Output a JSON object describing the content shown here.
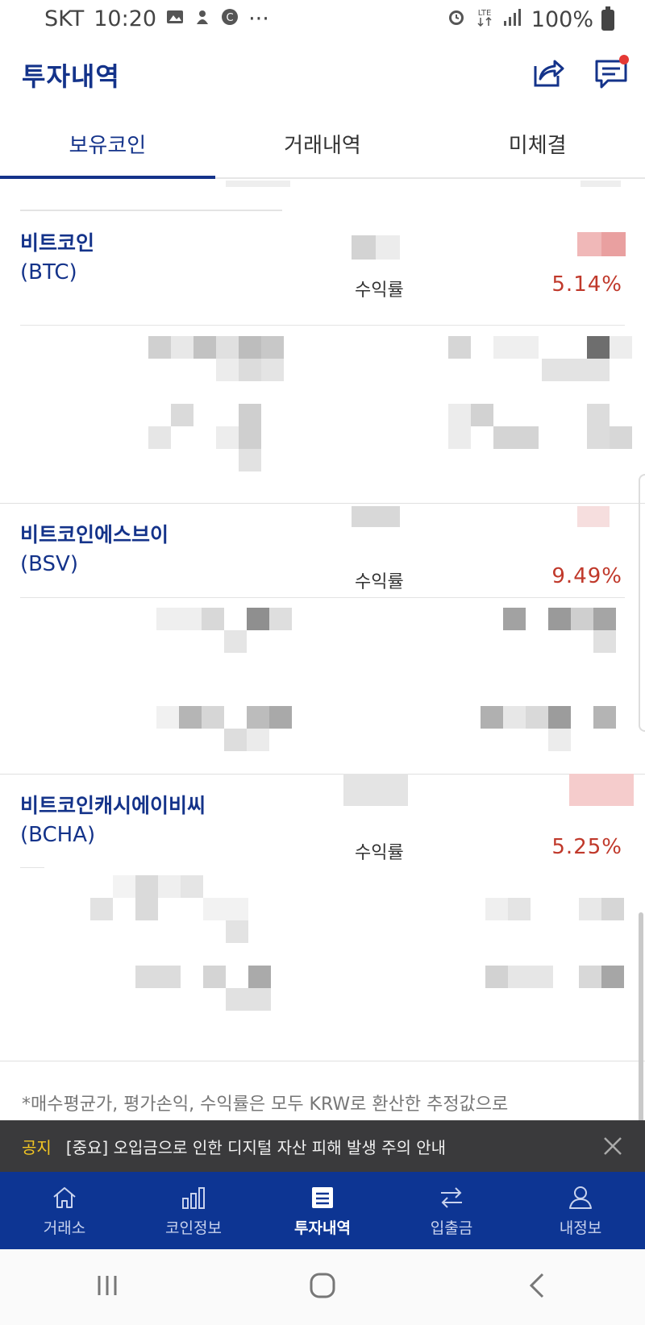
{
  "status_bar": {
    "carrier": "SKT",
    "time": "10:20",
    "icons": [
      "image-icon",
      "alarm-icon",
      "lte-icon",
      "signal-icon"
    ],
    "more": "···",
    "battery": "100%"
  },
  "header": {
    "title": "투자내역",
    "icons": [
      "share-icon",
      "chat-icon"
    ]
  },
  "tabs": [
    {
      "label": "보유코인",
      "active": true
    },
    {
      "label": "거래내역",
      "active": false
    },
    {
      "label": "미체결",
      "active": false
    }
  ],
  "holdings": [
    {
      "name": "비트코인",
      "symbol": "(BTC)",
      "yield_label": "수익률",
      "yield_value": "5.14%"
    },
    {
      "name": "비트코인에스브이",
      "symbol": "(BSV)",
      "yield_label": "수익률",
      "yield_value": "9.49%"
    },
    {
      "name": "비트코인캐시에이비씨",
      "symbol": "(BCHA)",
      "yield_label": "수익률",
      "yield_value": "5.25%"
    }
  ],
  "footnote": "*매수평균가, 평가손익, 수익률은 모두 KRW로 환산한 추정값으로",
  "notice": {
    "tag": "공지",
    "text": "[중요] 오입금으로 인한 디지털 자산 피해 발생 주의 안내"
  },
  "bottom_nav": [
    {
      "label": "거래소",
      "icon": "home-icon",
      "active": false
    },
    {
      "label": "코인정보",
      "icon": "bar-chart-icon",
      "active": false
    },
    {
      "label": "투자내역",
      "icon": "list-doc-icon",
      "active": true
    },
    {
      "label": "입출금",
      "icon": "transfer-icon",
      "active": false
    },
    {
      "label": "내정보",
      "icon": "person-icon",
      "active": false
    }
  ],
  "colors": {
    "brand_blue": "#0d3593",
    "title_blue": "#14338a",
    "profit_red": "#c0392b",
    "notice_bg": "#3a3a3c",
    "notice_tag": "#f3c623"
  }
}
